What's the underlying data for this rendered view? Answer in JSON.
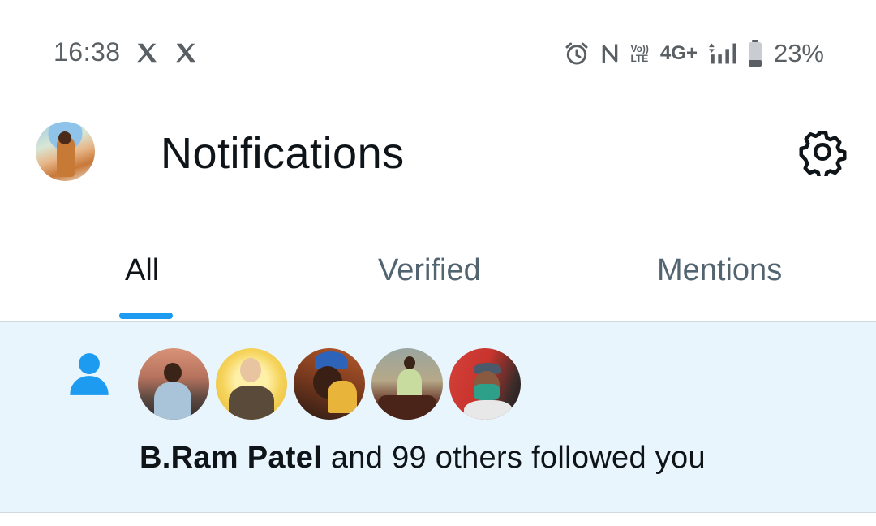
{
  "status_bar": {
    "time": "16:38",
    "notification_icons": [
      "x-logo-icon",
      "x-logo-icon"
    ],
    "status_icons": [
      "alarm-icon",
      "nfc-icon",
      "volte-icon",
      "4g-plus-icon",
      "signal-icon",
      "battery-icon"
    ],
    "volte_top": "Vo))",
    "volte_bottom": "LTE",
    "network": "4G+",
    "battery": "23%"
  },
  "header": {
    "title": "Notifications",
    "avatar": "profile-avatar",
    "settings_icon": "gear-icon"
  },
  "tabs": [
    {
      "label": "All",
      "active": true
    },
    {
      "label": "Verified",
      "active": false
    },
    {
      "label": "Mentions",
      "active": false
    }
  ],
  "notification": {
    "type_icon": "person-icon",
    "follower_avatars": 5,
    "actor": "B.Ram Patel",
    "text": " and 99 others followed you"
  },
  "colors": {
    "accent": "#1d9bf0",
    "notification_bg": "#e8f5fd",
    "text_primary": "#0f1419",
    "text_secondary": "#536471"
  }
}
